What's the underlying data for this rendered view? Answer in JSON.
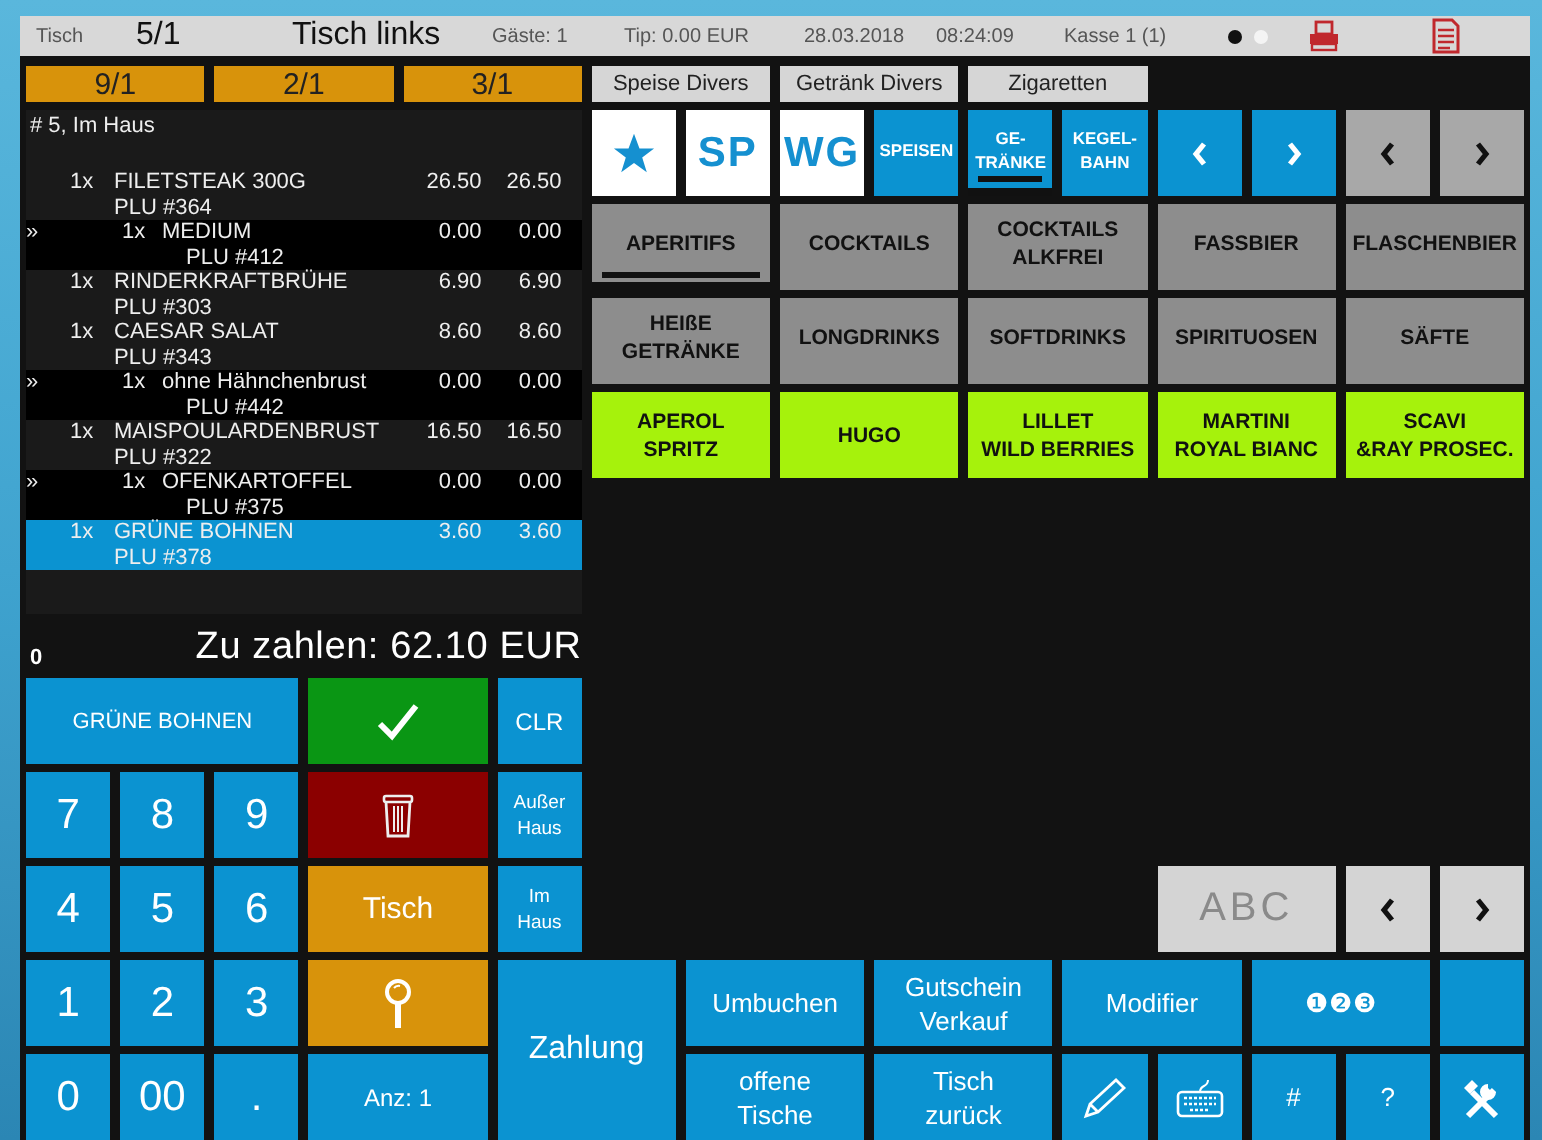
{
  "header": {
    "table_label": "Tisch",
    "table": "5/1",
    "area": "Tisch links",
    "guests": "Gäste: 1",
    "tip": "Tip: 0.00 EUR",
    "date": "28.03.2018",
    "time": "08:24:09",
    "register": "Kasse 1 (1)",
    "pages": [
      {
        "selected": true
      },
      {
        "selected": false
      }
    ]
  },
  "table_tabs": [
    {
      "label": "9/1"
    },
    {
      "label": "2/1"
    },
    {
      "label": "3/1"
    }
  ],
  "quick_buttons": [
    {
      "label": "Speise Divers"
    },
    {
      "label": "Getränk Divers"
    },
    {
      "label": "Zigaretten"
    }
  ],
  "order": {
    "title": "# 5, Im Haus",
    "items": [
      {
        "qty": "1x",
        "name": "FILETSTEAK 300G",
        "plu": "PLU #364",
        "price": "26.50",
        "total": "26.50",
        "selected": false,
        "children": [
          {
            "marker": "»",
            "qty": "1x",
            "name": "MEDIUM",
            "plu": "PLU #412",
            "price": "0.00",
            "total": "0.00",
            "selected": false
          }
        ]
      },
      {
        "qty": "1x",
        "name": "RINDERKRAFTBRÜHE",
        "plu": "PLU #303",
        "price": "6.90",
        "total": "6.90",
        "selected": false
      },
      {
        "qty": "1x",
        "name": "CAESAR SALAT",
        "plu": "PLU #343",
        "price": "8.60",
        "total": "8.60",
        "selected": false,
        "children": [
          {
            "marker": "»",
            "qty": "1x",
            "name": "ohne Hähnchenbrust",
            "plu": "PLU #442",
            "price": "0.00",
            "total": "0.00",
            "selected": false
          }
        ]
      },
      {
        "qty": "1x",
        "name": "MAISPOULARDENBRUST",
        "plu": "PLU #322",
        "price": "16.50",
        "total": "16.50",
        "selected": false,
        "children": [
          {
            "marker": "»",
            "qty": "1x",
            "name": "OFENKARTOFFEL",
            "plu": "PLU #375",
            "price": "0.00",
            "total": "0.00",
            "selected": false
          }
        ]
      },
      {
        "qty": "1x",
        "name": "GRÜNE BOHNEN",
        "plu": "PLU #378",
        "price": "3.60",
        "total": "3.60",
        "selected": true
      }
    ]
  },
  "group_bar": [
    {
      "kind": "favorite"
    },
    {
      "kind": "shortcut",
      "label": "SP"
    },
    {
      "kind": "shortcut",
      "label": "WG"
    },
    {
      "kind": "group",
      "label": "SPEISEN",
      "selected": false
    },
    {
      "kind": "group",
      "label": "GE-\nTRÄNKE",
      "selected": true
    },
    {
      "kind": "group",
      "label": "KEGEL-\nBAHN",
      "selected": false
    },
    {
      "kind": "prev"
    },
    {
      "kind": "next"
    }
  ],
  "category_nav": [
    {
      "kind": "prev"
    },
    {
      "kind": "next"
    }
  ],
  "categories": [
    {
      "label": "APERITIFS",
      "selected": true
    },
    {
      "label": "COCKTAILS",
      "selected": false
    },
    {
      "label": "COCKTAILS\nALKFREI",
      "selected": false
    },
    {
      "label": "FASSBIER",
      "selected": false
    },
    {
      "label": "FLASCHENBIER",
      "selected": false
    },
    {
      "label": "HEIßE\nGETRÄNKE",
      "selected": false
    },
    {
      "label": "LONGDRINKS",
      "selected": false
    },
    {
      "label": "SOFTDRINKS",
      "selected": false
    },
    {
      "label": "SPIRITUOSEN",
      "selected": false
    },
    {
      "label": "SÄFTE",
      "selected": false
    }
  ],
  "products": [
    {
      "label": "APEROL\nSPRITZ"
    },
    {
      "label": "HUGO"
    },
    {
      "label": "LILLET\nWILD BERRIES"
    },
    {
      "label": "MARTINI\nROYAL BIANC"
    },
    {
      "label": "SCAVI\n&RAY PROSEC."
    }
  ],
  "product_pager": {
    "search": {
      "label": "ABC",
      "disabled": true
    },
    "nav": [
      {
        "kind": "prev"
      },
      {
        "kind": "next"
      }
    ]
  },
  "total": {
    "entry": "0",
    "label": "Zu zahlen: 62.10 EUR"
  },
  "keypad": {
    "display": "GRÜNE BOHNEN",
    "digits": [
      "7",
      "8",
      "9",
      "4",
      "5",
      "6",
      "1",
      "2",
      "3",
      "0",
      "00",
      "."
    ]
  },
  "actions": {
    "table": "Tisch",
    "quantity": "Anz: 1",
    "clear": "CLR",
    "takeaway": "Außer\nHaus",
    "dine_in": "Im\nHaus",
    "pay": "Zahlung"
  },
  "functions": [
    {
      "kind": "text",
      "label": "Umbuchen"
    },
    {
      "kind": "text",
      "label": "Gutschein\nVerkauf"
    },
    {
      "kind": "text",
      "label": "Modifier"
    },
    {
      "kind": "text",
      "label": "❶❷❸"
    },
    {
      "kind": "blank"
    },
    {
      "kind": "text",
      "label": "offene\nTische"
    },
    {
      "kind": "text",
      "label": "Tisch\nzurück"
    },
    {
      "kind": "pencil"
    },
    {
      "kind": "keyboard"
    },
    {
      "kind": "text",
      "label": "#"
    },
    {
      "kind": "text",
      "label": "?"
    },
    {
      "kind": "tools"
    }
  ]
}
